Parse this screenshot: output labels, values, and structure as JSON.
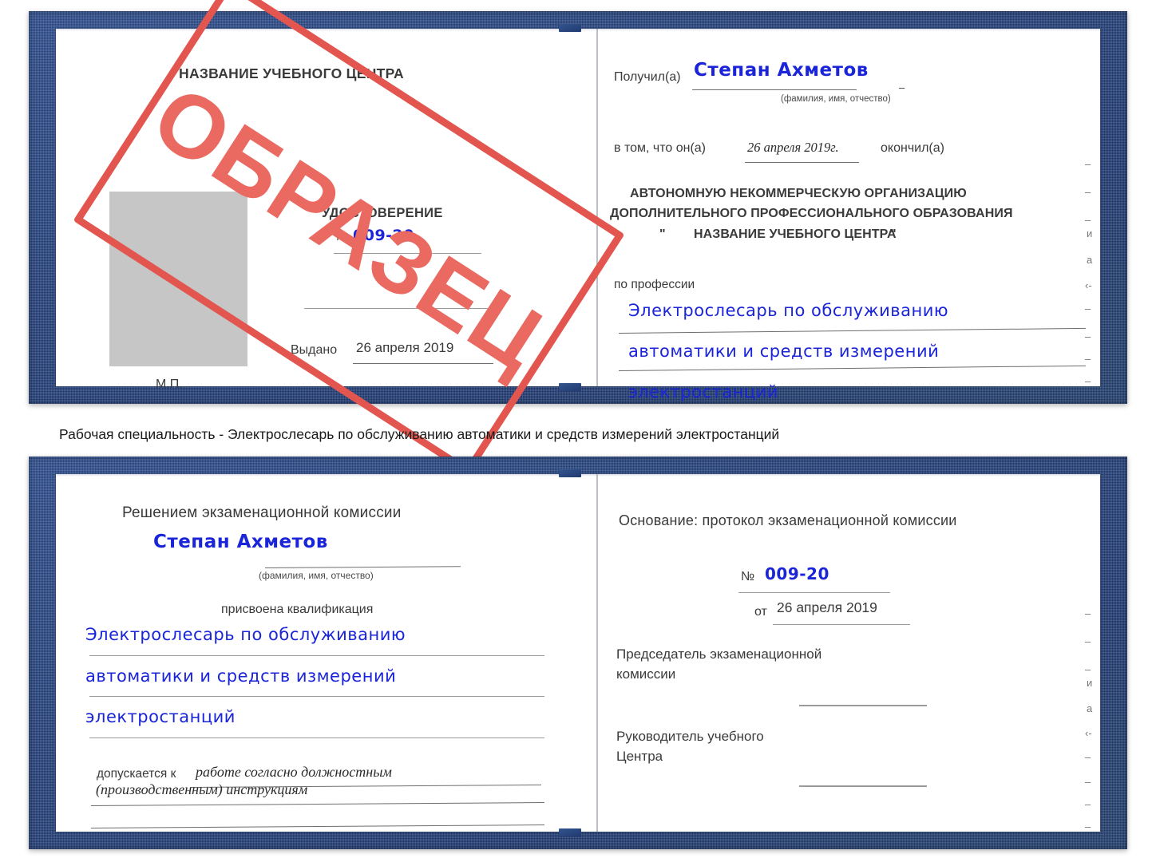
{
  "document": {
    "type": "certificate-booklet",
    "watermark": {
      "text": "ОБРАЗЕЦ",
      "color": "#e2564f"
    },
    "caption": "Рабочая специальность - Электрослесарь по обслуживанию автоматики и средств измерений электростанций",
    "colors": {
      "cover_blue": "#25427d",
      "handwriting_blue": "#1a24d8",
      "stamp_red": "#e2564f",
      "photo_placeholder_gray": "#c6c6c6"
    }
  },
  "certificate_top": {
    "left_page": {
      "org_title": "НАЗВАНИЕ УЧЕБНОГО ЦЕНТРА",
      "doc_type": "УДОСТОВЕРЕНИЕ",
      "number_label": "№",
      "number_value": "009-20",
      "issued_label": "Выдано",
      "issued_value": "26 апреля 2019",
      "seal_label": "М.П.",
      "photo_placeholder": "photo-box"
    },
    "right_page": {
      "received_label": "Получил(а)",
      "received_value": "Степан Ахметов",
      "name_hint": "(фамилия, имя, отчество)",
      "in_that_label": "в том, что он(а)",
      "in_that_value": "26 апреля 2019г.",
      "graduated_label": "окончил(а)",
      "org_line1": "АВТОНОМНУЮ НЕКОММЕРЧЕСКУЮ ОРГАНИЗАЦИЮ",
      "org_line2": "ДОПОЛНИТЕЛЬНОГО ПРОФЕССИОНАЛЬНОГО ОБРАЗОВАНИЯ",
      "org_quote_open": "\"",
      "org_line3": "НАЗВАНИЕ УЧЕБНОГО ЦЕНТРА",
      "org_quote_close": "\"",
      "profession_label": "по профессии",
      "profession_line1": "Электрослесарь по обслуживанию",
      "profession_line2": "автоматики и средств измерений",
      "profession_line3": "электростанций",
      "margin_marks": [
        "–",
        "–",
        "–",
        "и",
        "а",
        "‹-",
        "–",
        "–",
        "–",
        "–"
      ]
    }
  },
  "certificate_bottom": {
    "left_page": {
      "decision_label": "Решением экзаменационной комиссии",
      "name_value": "Степан Ахметов",
      "name_hint": "(фамилия, имя, отчество)",
      "qualification_label": "присвоена квалификация",
      "qualification_line1": "Электрослесарь по обслуживанию",
      "qualification_line2": "автоматики и средств измерений",
      "qualification_line3": "электростанций",
      "admitted_label": "допускается к",
      "admitted_line1": "работе согласно должностным",
      "admitted_line2": "(производственным) инструкциям"
    },
    "right_page": {
      "basis_label": "Основание: протокол экзаменационной комиссии",
      "protocol_number_label": "№",
      "protocol_number_value": "009-20",
      "protocol_date_label": "от",
      "protocol_date_value": "26 апреля 2019",
      "chairman_line1": "Председатель экзаменационной",
      "chairman_line2": "комиссии",
      "head_line1": "Руководитель учебного",
      "head_line2": "Центра",
      "margin_marks": [
        "–",
        "–",
        "–",
        "и",
        "а",
        "‹-",
        "–",
        "–",
        "–",
        "–"
      ]
    }
  }
}
